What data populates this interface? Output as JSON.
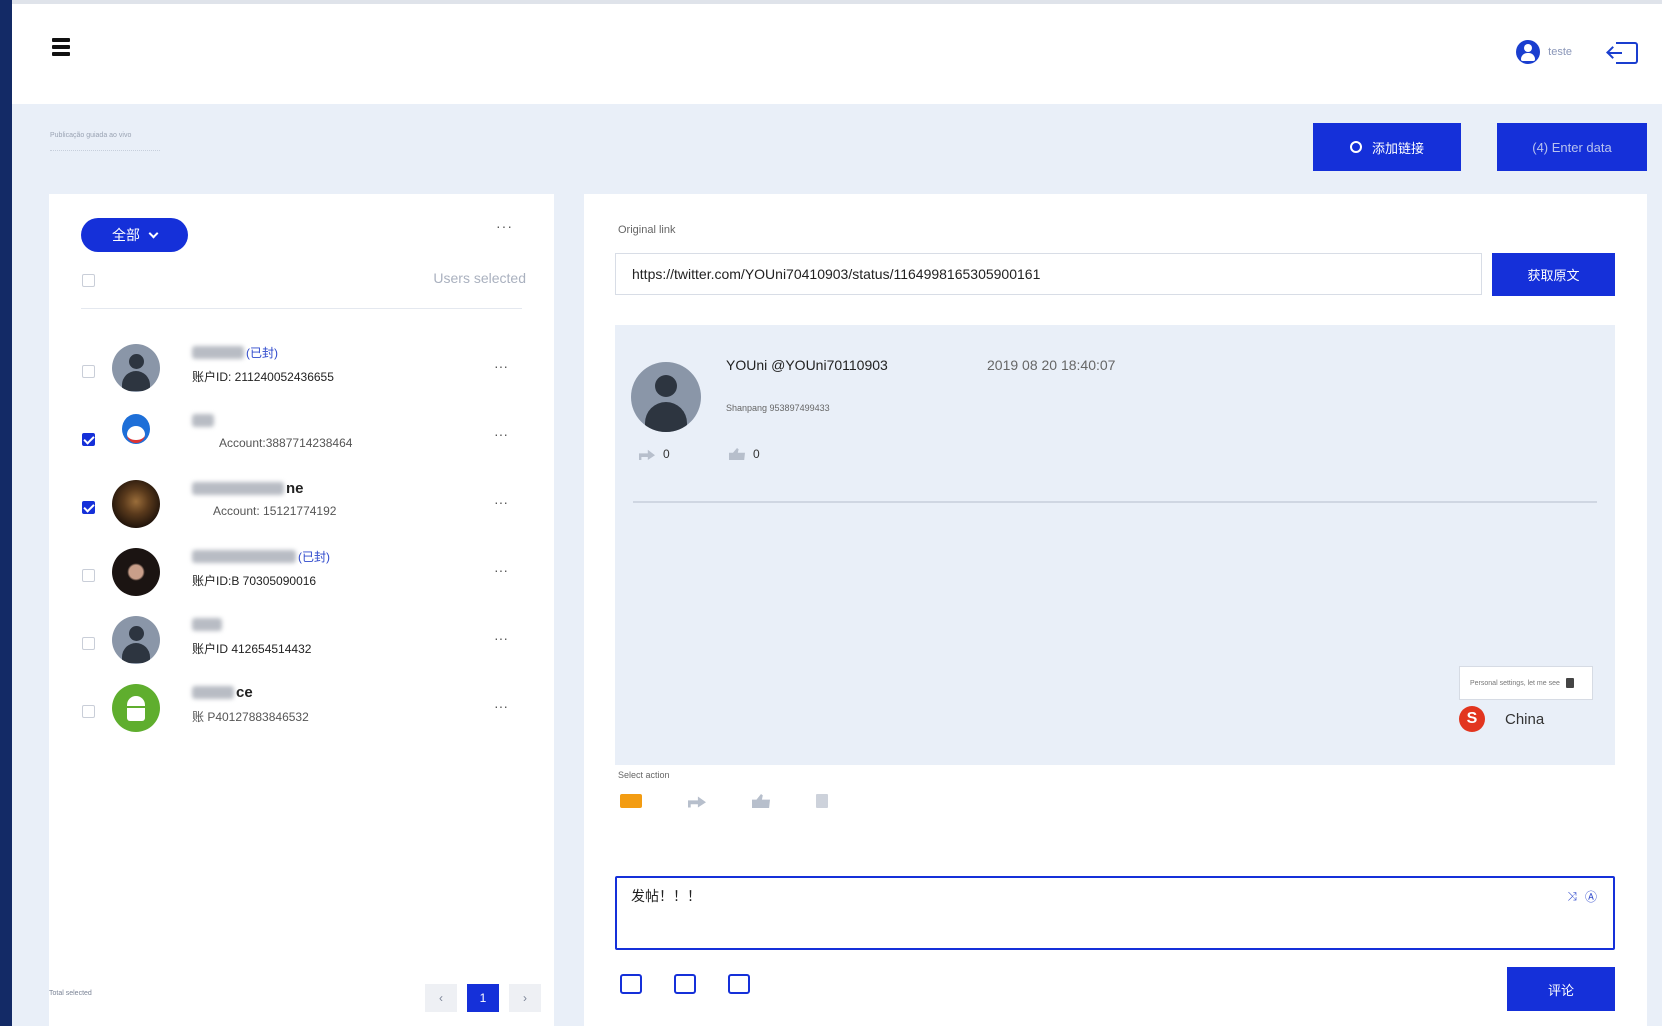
{
  "topbar": {
    "user_name": "teste",
    "user_icon": "user-circle-icon",
    "logout_icon": "logout-icon",
    "menu_icon": "hamburger-icon"
  },
  "breadcrumb": "Publicação guiada ao vivo",
  "buttons": {
    "add_label": "添加链接",
    "enter_label": "(4) Enter data",
    "fetch_label": "获取原文",
    "send_label": "评论"
  },
  "users_panel": {
    "filter_label": "全部",
    "more": "···",
    "users_selected": "Users selected",
    "users": [
      {
        "name_suffix": "(已封)",
        "account": "账户ID:  211240052436655",
        "checked": false,
        "avatar": "default"
      },
      {
        "name_suffix": "",
        "account": "Account:3887714238464",
        "checked": true,
        "avatar": "doraemon"
      },
      {
        "name_end": "ne",
        "account": "Account:   15121774192",
        "checked": true,
        "avatar": "dark"
      },
      {
        "name_suffix": "(已封)",
        "account": "账户ID:B      70305090016",
        "checked": false,
        "avatar": "portrait"
      },
      {
        "name_suffix": "",
        "account": "账户ID       412654514432",
        "checked": false,
        "avatar": "default"
      },
      {
        "name_end": "ce",
        "account": "账    P40127883846532",
        "checked": false,
        "avatar": "android"
      }
    ],
    "pagination": {
      "prev": "‹",
      "current": "1",
      "next": "›"
    },
    "footer_note": "Total selected"
  },
  "post_panel": {
    "original_link_label": "Original link",
    "url": "https://twitter.com/YOUni70410903/status/1164998165305900161",
    "tweet": {
      "user": "YOUni @YOUni70110903",
      "time": "2019 08 20 18:40:07",
      "text": "Shanpang 953897499433",
      "shares": "0",
      "likes": "0"
    },
    "select_action_label": "Select action",
    "reply_text": "发帖！！！",
    "ime_popup": "Personal settings, let me see",
    "ime_region": "China"
  },
  "colors": {
    "accent": "#1530d9",
    "background": "#e9eff8",
    "rail": "#132a66",
    "comment_action": "#f39c12"
  }
}
